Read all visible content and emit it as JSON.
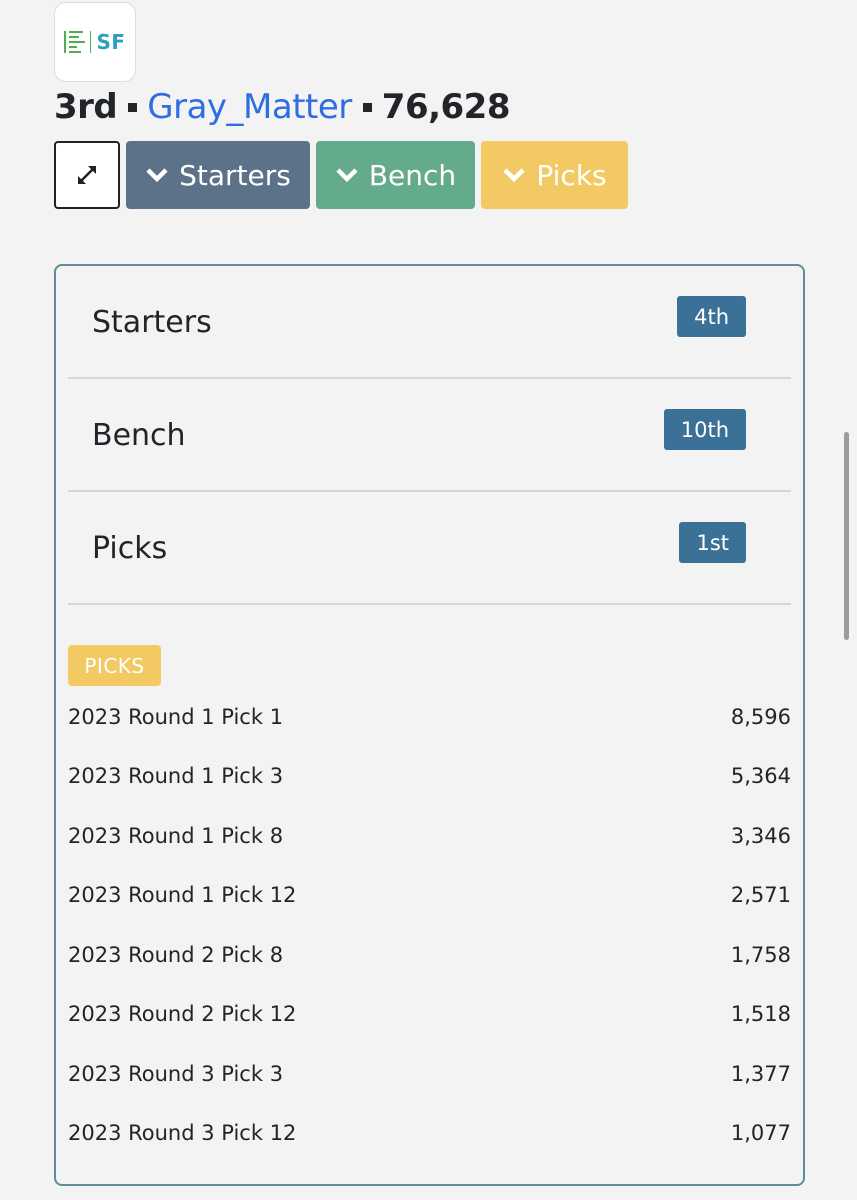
{
  "header": {
    "logo_text": "SF",
    "rank": "3rd",
    "team_name": "Gray_Matter",
    "total_value": "76,628"
  },
  "toolbar": {
    "expand_icon": "expand-arrows-icon",
    "starters_label": "Starters",
    "bench_label": "Bench",
    "picks_label": "Picks"
  },
  "categories": [
    {
      "label": "Starters",
      "rank": "4th"
    },
    {
      "label": "Bench",
      "rank": "10th"
    },
    {
      "label": "Picks",
      "rank": "1st"
    }
  ],
  "picks_section": {
    "tag": "PICKS",
    "items": [
      {
        "name": "2023 Round 1 Pick 1",
        "value": "8,596"
      },
      {
        "name": "2023 Round 1 Pick 3",
        "value": "5,364"
      },
      {
        "name": "2023 Round 1 Pick 8",
        "value": "3,346"
      },
      {
        "name": "2023 Round 1 Pick 12",
        "value": "2,571"
      },
      {
        "name": "2023 Round 2 Pick 8",
        "value": "1,758"
      },
      {
        "name": "2023 Round 2 Pick 12",
        "value": "1,518"
      },
      {
        "name": "2023 Round 3 Pick 3",
        "value": "1,377"
      },
      {
        "name": "2023 Round 3 Pick 12",
        "value": "1,077"
      }
    ]
  },
  "colors": {
    "starters": "#5b7288",
    "bench": "#63ab8a",
    "picks": "#f2c963",
    "badge": "#3b7197",
    "link": "#2f6ee0",
    "card_border": "#5d8f93"
  }
}
